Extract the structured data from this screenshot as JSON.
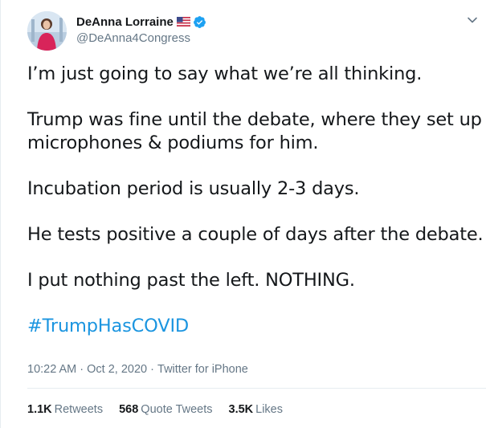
{
  "tweet": {
    "author": {
      "display_name": "DeAnna Lorraine",
      "handle": "@DeAnna4Congress"
    },
    "paragraphs": [
      "I’m just going to say what we’re all thinking.",
      "Trump was fine until the debate, where they set up",
      "microphones & podiums for him.",
      "Incubation period is usually 2-3 days.",
      "He tests positive a couple of days after the debate.",
      "I put nothing past the left. NOTHING."
    ],
    "hashtag": "#TrumpHasCOVID",
    "time": "10:22 AM",
    "date": "Oct 2, 2020",
    "source": "Twitter for iPhone",
    "stats": {
      "retweets_count": "1.1K",
      "retweets_label": "Retweets",
      "quotes_count": "568",
      "quotes_label": "Quote Tweets",
      "likes_count": "3.5K",
      "likes_label": "Likes"
    }
  },
  "colors": {
    "link": "#1b95e0",
    "verified": "#1da1f2",
    "secondary_text": "#657786",
    "primary_text": "#14171a"
  },
  "icons": [
    "avatar",
    "us-flag-icon",
    "verified-badge-icon",
    "chevron-down-icon"
  ]
}
